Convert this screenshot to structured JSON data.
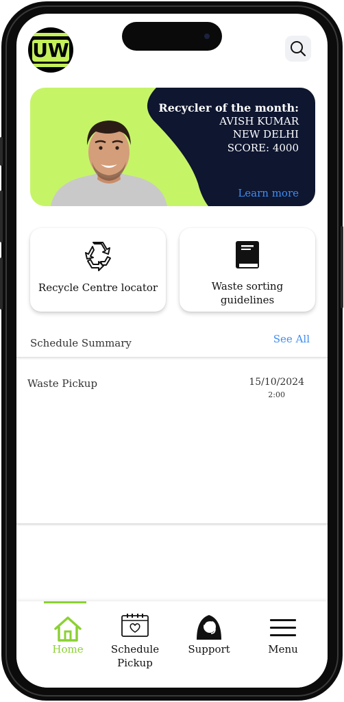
{
  "app": {
    "logo_text": "UW",
    "accent_color": "#c4f05a",
    "link_color": "#3e8df3",
    "banner_dark_color": "#0e1630"
  },
  "header": {
    "search_icon": "search-icon"
  },
  "banner": {
    "title": "Recycler of the month:",
    "name": "AVISH KUMAR",
    "city": "NEW DELHI",
    "score": "SCORE: 4000",
    "learn_more": "Learn more"
  },
  "cards": [
    {
      "icon": "recycle-icon",
      "label": "Recycle Centre locator"
    },
    {
      "icon": "book-icon",
      "label_line1": "Waste sorting",
      "label_line2": "guidelines"
    }
  ],
  "schedule": {
    "title": "Schedule Summary",
    "see_all": "See All",
    "items": [
      {
        "name": "Waste Pickup",
        "date": "15/10/2024",
        "time": "2:00"
      }
    ]
  },
  "nav": {
    "tabs": [
      {
        "icon": "home-icon",
        "label": "Home",
        "active": true
      },
      {
        "icon": "calendar-icon",
        "label_line1": "Schedule",
        "label_line2": "Pickup"
      },
      {
        "icon": "support-agent-icon",
        "label": "Support"
      },
      {
        "icon": "hamburger-menu-icon",
        "label": "Menu"
      }
    ]
  }
}
